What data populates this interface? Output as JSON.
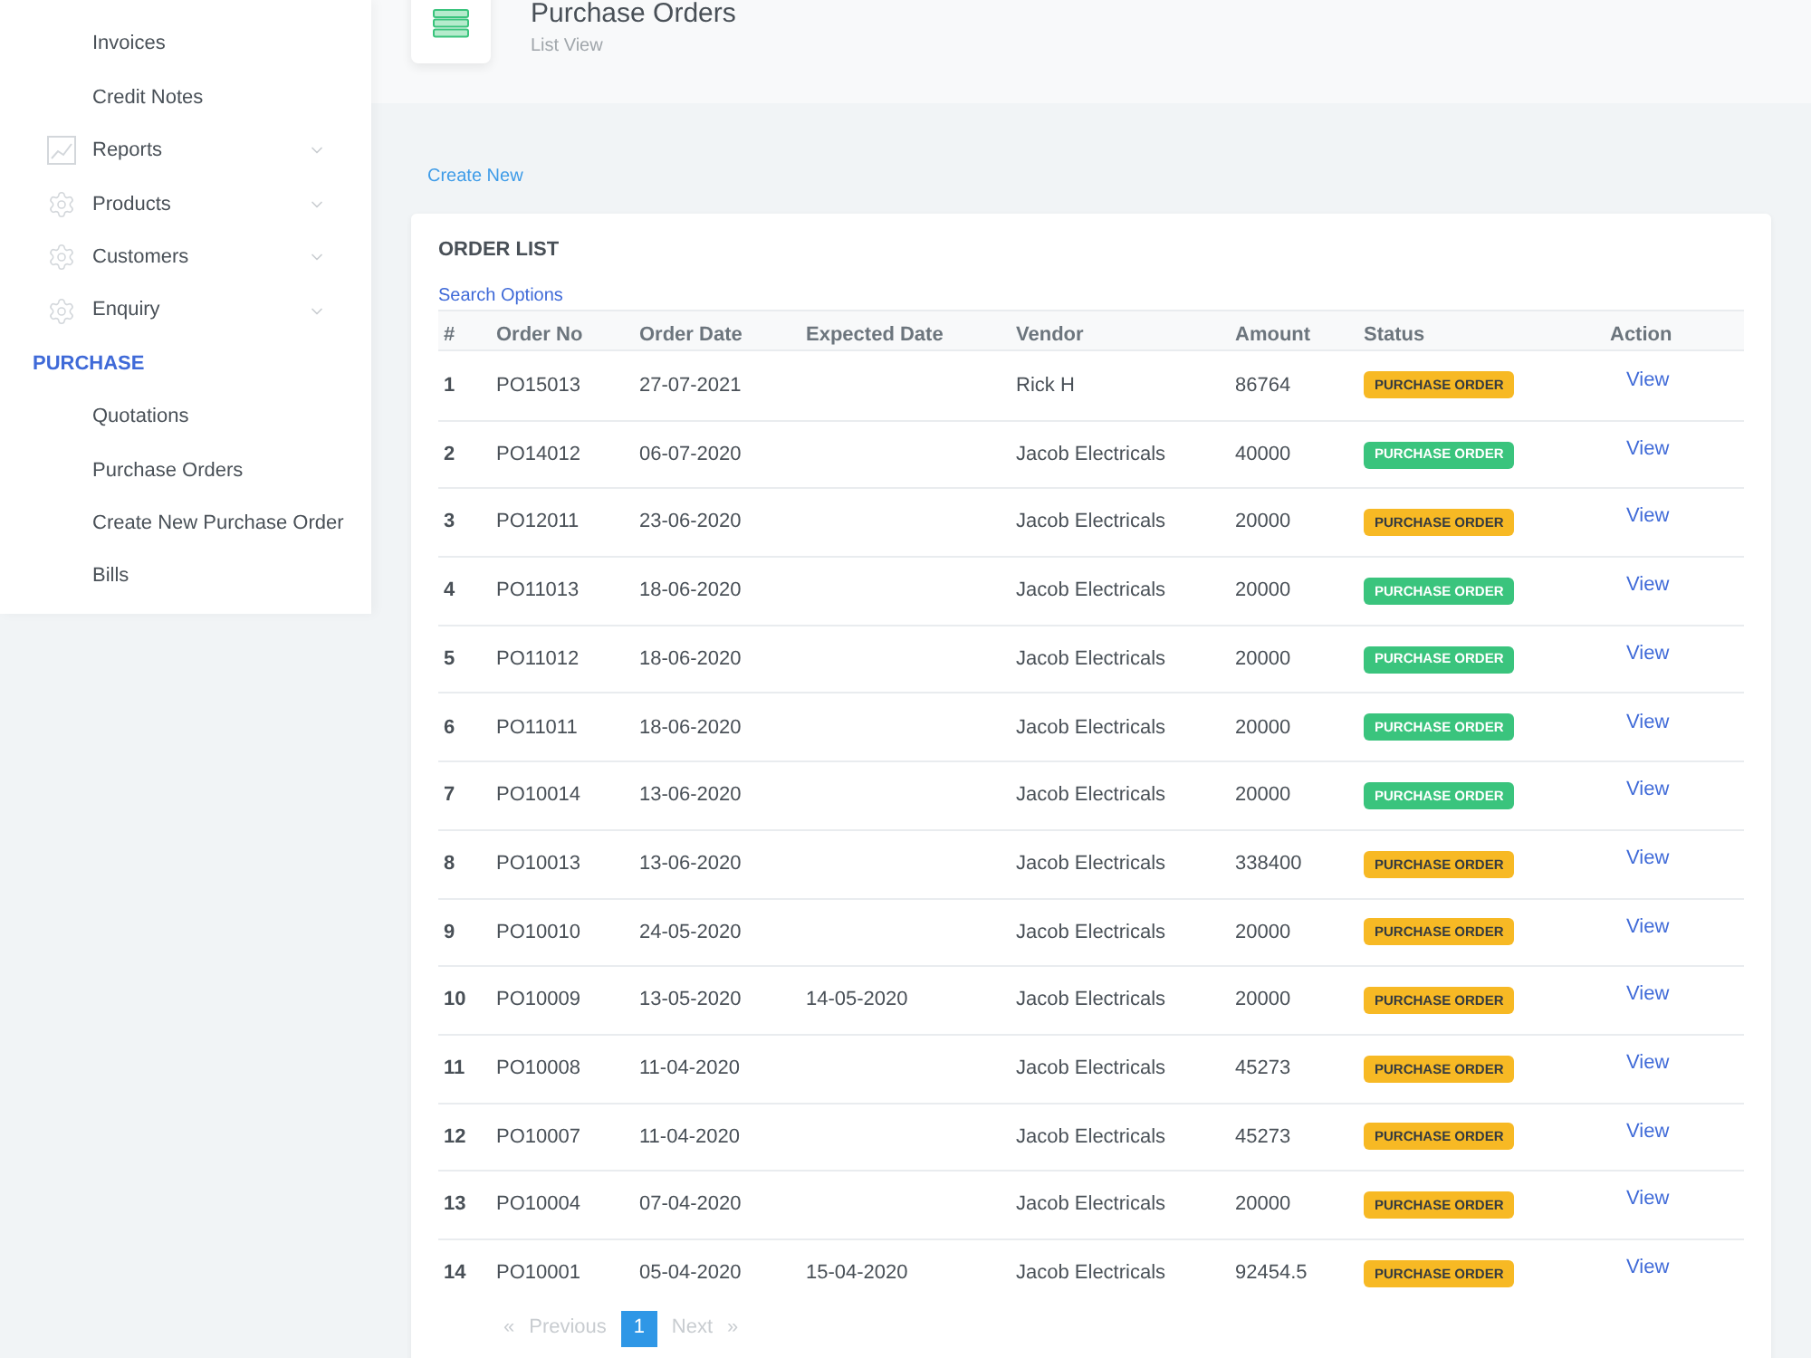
{
  "sidebar": {
    "items": [
      {
        "kind": "link",
        "label": "Invoices"
      },
      {
        "kind": "link",
        "label": "Credit Notes"
      },
      {
        "kind": "menu",
        "label": "Reports",
        "expanded": false
      },
      {
        "kind": "menu",
        "label": "Products",
        "expanded": false
      },
      {
        "kind": "menu",
        "label": "Customers",
        "expanded": false
      },
      {
        "kind": "menu",
        "label": "Enquiry",
        "expanded": false
      },
      {
        "kind": "heading",
        "label": "PURCHASE"
      },
      {
        "kind": "link",
        "label": "Quotations"
      },
      {
        "kind": "link",
        "label": "Purchase Orders"
      },
      {
        "kind": "link",
        "label": "Create New Purchase Order"
      },
      {
        "kind": "link",
        "label": "Bills"
      }
    ]
  },
  "page_header": {
    "title": "Purchase Orders",
    "subtitle": "List View"
  },
  "create_link": "Create New",
  "card": {
    "title": "ORDER LIST",
    "search_link": "Search Options",
    "table": {
      "columns": [
        "#",
        "Order No",
        "Order Date",
        "Expected Date",
        "Vendor",
        "Amount",
        "Status",
        "Action"
      ],
      "rows": [
        {
          "number": "1",
          "order_no": "PO15013",
          "order_date": "27-07-2021",
          "vendor": "Rick H",
          "amount": "86764",
          "status": {
            "label": "PURCHASE ORDER",
            "color": "#f7b924"
          },
          "action": "View"
        },
        {
          "number": "2",
          "order_no": "PO14012",
          "order_date": "06-07-2020",
          "vendor": "Jacob Electricals",
          "amount": "40000",
          "status": {
            "label": "PURCHASE ORDER",
            "color": "#3ac47d"
          },
          "action": "View"
        },
        {
          "number": "3",
          "order_no": "PO12011",
          "order_date": "23-06-2020",
          "vendor": "Jacob Electricals",
          "amount": "20000",
          "status": {
            "label": "PURCHASE ORDER",
            "color": "#f7b924"
          },
          "action": "View"
        },
        {
          "number": "4",
          "order_no": "PO11013",
          "order_date": "18-06-2020",
          "vendor": "Jacob Electricals",
          "amount": "20000",
          "status": {
            "label": "PURCHASE ORDER",
            "color": "#3ac47d"
          },
          "action": "View"
        },
        {
          "number": "5",
          "order_no": "PO11012",
          "order_date": "18-06-2020",
          "vendor": "Jacob Electricals",
          "amount": "20000",
          "status": {
            "label": "PURCHASE ORDER",
            "color": "#3ac47d"
          },
          "action": "View"
        },
        {
          "number": "6",
          "order_no": "PO11011",
          "order_date": "18-06-2020",
          "vendor": "Jacob Electricals",
          "amount": "20000",
          "status": {
            "label": "PURCHASE ORDER",
            "color": "#3ac47d"
          },
          "action": "View"
        },
        {
          "number": "7",
          "order_no": "PO10014",
          "order_date": "13-06-2020",
          "vendor": "Jacob Electricals",
          "amount": "20000",
          "status": {
            "label": "PURCHASE ORDER",
            "color": "#3ac47d"
          },
          "action": "View"
        },
        {
          "number": "8",
          "order_no": "PO10013",
          "order_date": "13-06-2020",
          "vendor": "Jacob Electricals",
          "amount": "338400",
          "status": {
            "label": "PURCHASE ORDER",
            "color": "#f7b924"
          },
          "action": "View"
        },
        {
          "number": "9",
          "order_no": "PO10010",
          "order_date": "24-05-2020",
          "vendor": "Jacob Electricals",
          "amount": "20000",
          "status": {
            "label": "PURCHASE ORDER",
            "color": "#f7b924"
          },
          "action": "View"
        },
        {
          "number": "10",
          "order_no": "PO10009",
          "order_date": "13-05-2020",
          "expected_date": "14-05-2020",
          "vendor": "Jacob Electricals",
          "amount": "20000",
          "status": {
            "label": "PURCHASE ORDER",
            "color": "#f7b924"
          },
          "action": "View"
        },
        {
          "number": "11",
          "order_no": "PO10008",
          "order_date": "11-04-2020",
          "vendor": "Jacob Electricals",
          "amount": "45273",
          "status": {
            "label": "PURCHASE ORDER",
            "color": "#f7b924"
          },
          "action": "View"
        },
        {
          "number": "12",
          "order_no": "PO10007",
          "order_date": "11-04-2020",
          "vendor": "Jacob Electricals",
          "amount": "45273",
          "status": {
            "label": "PURCHASE ORDER",
            "color": "#f7b924"
          },
          "action": "View"
        },
        {
          "number": "13",
          "order_no": "PO10004",
          "order_date": "07-04-2020",
          "vendor": "Jacob Electricals",
          "amount": "20000",
          "status": {
            "label": "PURCHASE ORDER",
            "color": "#f7b924"
          },
          "action": "View"
        },
        {
          "number": "14",
          "order_no": "PO10001",
          "order_date": "05-04-2020",
          "expected_date": "15-04-2020",
          "vendor": "Jacob Electricals",
          "amount": "92454.5",
          "status": {
            "label": "PURCHASE ORDER",
            "color": "#f7b924"
          },
          "action": "View"
        }
      ]
    },
    "pagination": {
      "previous": {
        "arrow": "«",
        "label": "Previous",
        "disabled": true
      },
      "pages": [
        {
          "label": "1",
          "selected": true
        }
      ],
      "next": {
        "label": "Next",
        "arrow": "»",
        "disabled": true
      }
    }
  }
}
